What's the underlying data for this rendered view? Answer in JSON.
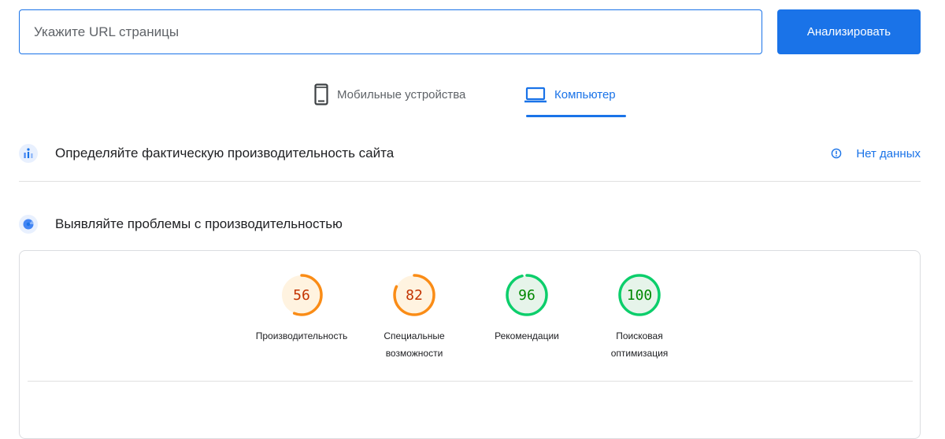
{
  "search": {
    "placeholder": "Укажите URL страницы",
    "value": "",
    "analyze_label": "Анализировать"
  },
  "tabs": [
    {
      "label": "Мобильные устройства",
      "icon": "smartphone-icon",
      "selected": false
    },
    {
      "label": "Компьютер",
      "icon": "laptop-icon",
      "selected": true
    }
  ],
  "field_data": {
    "title": "Определяйте фактическую производительность сайта",
    "icon": "field-data-chart-icon",
    "status_label": "Нет данных",
    "status_icon": "info-icon"
  },
  "lab_data": {
    "title": "Выявляйте проблемы с производительностью",
    "icon": "lighthouse-icon"
  },
  "scores": [
    {
      "value": 56,
      "label_lines": [
        "Производительность"
      ],
      "color": "#fa8c16",
      "fill": "#fff3e0",
      "text_color": "#c33300"
    },
    {
      "value": 82,
      "label_lines": [
        "Специальные",
        "возможности"
      ],
      "color": "#fa8c16",
      "fill": "#fff3e0",
      "text_color": "#c33300"
    },
    {
      "value": 96,
      "label_lines": [
        "Рекомендации"
      ],
      "color": "#0cce6b",
      "fill": "#e6f4ea",
      "text_color": "#008800"
    },
    {
      "value": 100,
      "label_lines": [
        "Поисковая",
        "оптимизация"
      ],
      "color": "#0cce6b",
      "fill": "#e6f4ea",
      "text_color": "#008800"
    }
  ],
  "colors": {
    "accent": "#1a73e8",
    "average": "#fa8c16",
    "pass": "#0cce6b"
  }
}
